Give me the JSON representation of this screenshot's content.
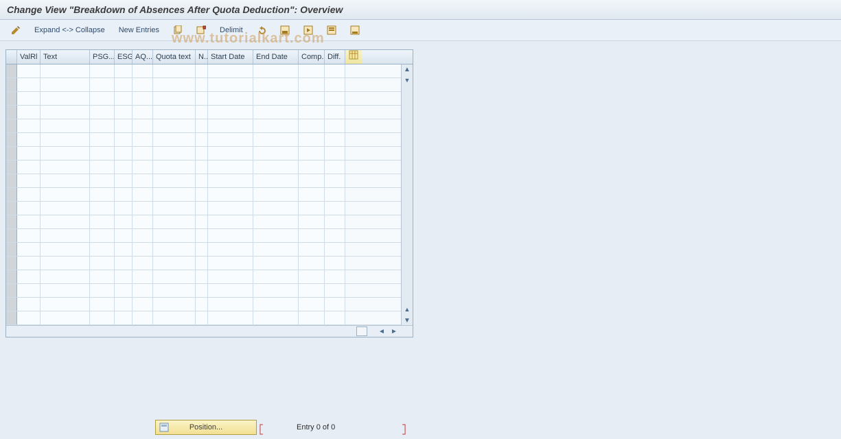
{
  "title": "Change View \"Breakdown of Absences After Quota Deduction\": Overview",
  "watermark": "www.tutorialkart.com",
  "toolbar": {
    "expand_collapse": "Expand <-> Collapse",
    "new_entries": "New Entries",
    "delimit": "Delimit"
  },
  "columns": {
    "valrl": "ValRl",
    "text": "Text",
    "psg": "PSG...",
    "esg": "ESG",
    "aq": "AQ...",
    "quota_text": "Quota text",
    "n": "N..",
    "start_date": "Start Date",
    "end_date": "End Date",
    "comp": "Comp.",
    "diff": "Diff."
  },
  "grid": {
    "rows": [
      {},
      {},
      {},
      {},
      {},
      {},
      {},
      {},
      {},
      {},
      {},
      {},
      {},
      {},
      {},
      {},
      {},
      {},
      {},
      {}
    ]
  },
  "footer": {
    "position_btn": "Position...",
    "entry_text": "Entry 0 of 0"
  },
  "icons": {
    "pencil": "pencil-icon",
    "copy": "copy-icon",
    "delete": "delete-icon",
    "undo": "undo-icon",
    "save": "save-icon",
    "save_next": "save-next-icon",
    "print": "print-icon",
    "table_settings": "table-settings-icon"
  }
}
